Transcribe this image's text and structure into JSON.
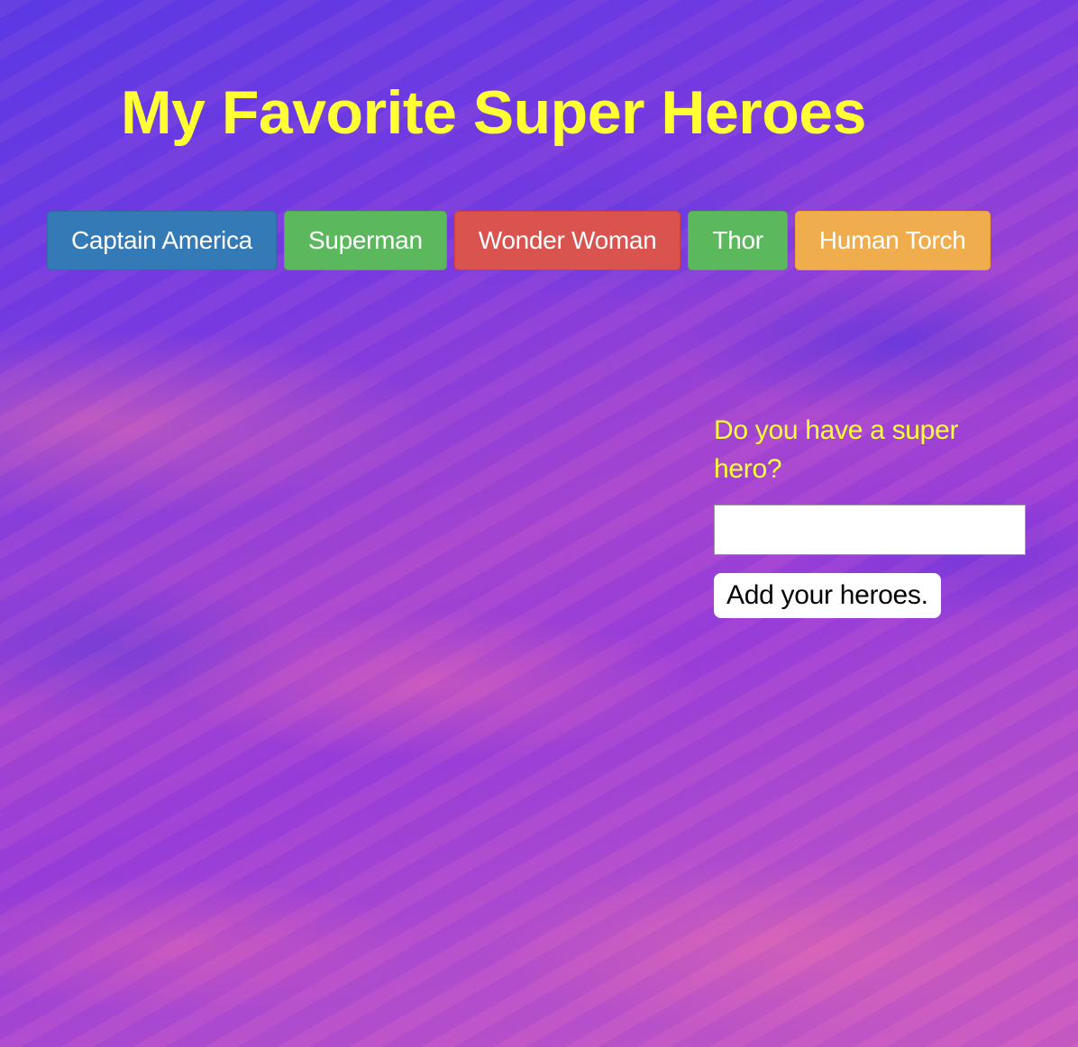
{
  "page": {
    "title": "My Favorite Super Heroes"
  },
  "heroes": [
    {
      "label": "Captain America",
      "style": "primary",
      "color": "#337ab7"
    },
    {
      "label": "Superman",
      "style": "success",
      "color": "#5cb85c"
    },
    {
      "label": "Wonder Woman",
      "style": "danger",
      "color": "#d9534f"
    },
    {
      "label": "Thor",
      "style": "success",
      "color": "#5cb85c"
    },
    {
      "label": "Human Torch",
      "style": "warning",
      "color": "#f0ad4e"
    }
  ],
  "add_form": {
    "prompt": "Do you have a super hero?",
    "input_value": "",
    "input_placeholder": "",
    "button_label": "Add your heroes."
  },
  "colors": {
    "title": "#ffff33",
    "prompt": "#ffff33",
    "background_accent": "#7a3ad8"
  }
}
